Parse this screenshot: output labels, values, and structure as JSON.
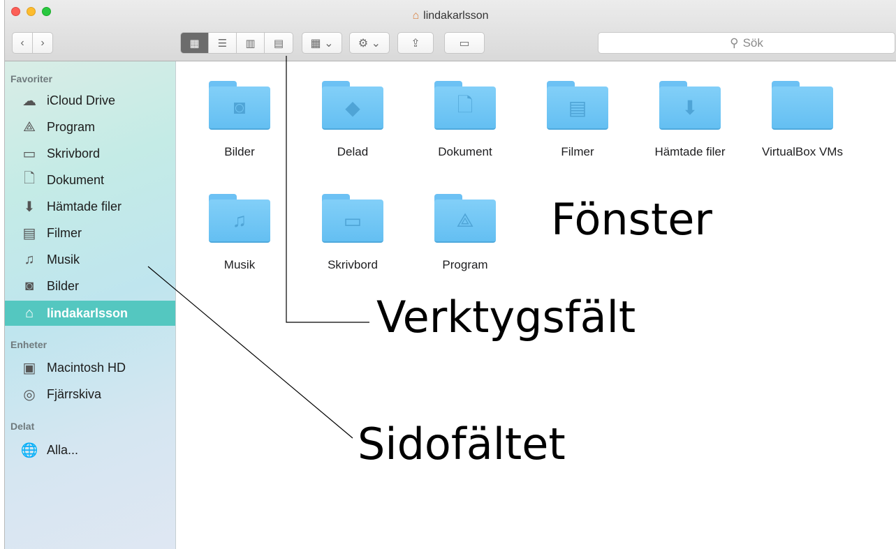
{
  "window": {
    "title": "lindakarlsson",
    "title_icon": "home-icon"
  },
  "toolbar": {
    "back_icon": "chevron-left-icon",
    "forward_icon": "chevron-right-icon",
    "view_modes": [
      "icon-view-icon",
      "list-view-icon",
      "column-view-icon",
      "coverflow-view-icon"
    ],
    "arrange_icon": "arrange-grid-icon",
    "action_icon": "gear-icon",
    "share_icon": "share-icon",
    "tag_icon": "tag-icon",
    "search_placeholder": "Sök"
  },
  "sidebar": {
    "favorites_header": "Favoriter",
    "favorites": [
      {
        "label": "iCloud Drive",
        "icon": "cloud-icon"
      },
      {
        "label": "Program",
        "icon": "applications-icon"
      },
      {
        "label": "Skrivbord",
        "icon": "desktop-icon"
      },
      {
        "label": "Dokument",
        "icon": "document-icon"
      },
      {
        "label": "Hämtade filer",
        "icon": "download-icon"
      },
      {
        "label": "Filmer",
        "icon": "film-icon"
      },
      {
        "label": "Musik",
        "icon": "music-icon"
      },
      {
        "label": "Bilder",
        "icon": "camera-icon"
      },
      {
        "label": "lindakarlsson",
        "icon": "home-icon",
        "selected": true
      }
    ],
    "devices_header": "Enheter",
    "devices": [
      {
        "label": "Macintosh HD",
        "icon": "harddisk-icon"
      },
      {
        "label": "Fjärrskiva",
        "icon": "disc-icon"
      }
    ],
    "shared_header": "Delat",
    "shared": [
      {
        "label": "Alla...",
        "icon": "network-icon"
      }
    ]
  },
  "folders": [
    {
      "name": "Bilder",
      "icon": "camera-icon"
    },
    {
      "name": "Delad",
      "icon": "shared-folder-icon"
    },
    {
      "name": "Dokument",
      "icon": "document-icon"
    },
    {
      "name": "Filmer",
      "icon": "film-icon"
    },
    {
      "name": "Hämtade filer",
      "icon": "download-icon"
    },
    {
      "name": "VirtualBox VMs",
      "icon": "folder-icon"
    },
    {
      "name": "Musik",
      "icon": "music-icon"
    },
    {
      "name": "Skrivbord",
      "icon": "desktop-icon"
    },
    {
      "name": "Program",
      "icon": "applications-icon"
    }
  ],
  "annotations": {
    "window_label": "Fönster",
    "toolbar_label": "Verktygsfält",
    "sidebar_label": "Sidofältet"
  }
}
